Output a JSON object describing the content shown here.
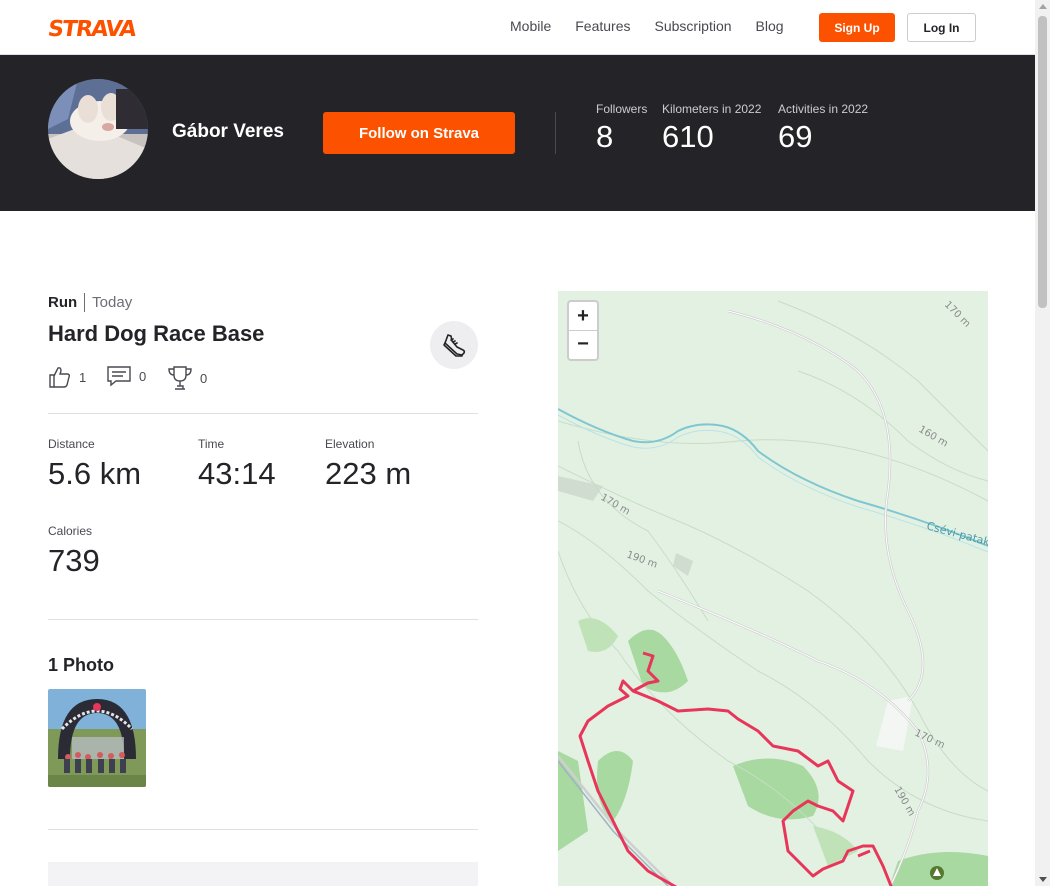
{
  "brand": {
    "logo_text": "STRAVA",
    "accent": "#fc5200",
    "dark": "#242428"
  },
  "nav": {
    "links": [
      "Mobile",
      "Features",
      "Subscription",
      "Blog"
    ],
    "signup_label": "Sign Up",
    "login_label": "Log In"
  },
  "athlete": {
    "name": "Gábor Veres",
    "follow_label": "Follow on Strava",
    "stats": [
      {
        "label": "Followers",
        "value": "8"
      },
      {
        "label": "Kilometers in 2022",
        "value": "610"
      },
      {
        "label": "Activities in 2022",
        "value": "69"
      }
    ]
  },
  "activity": {
    "type": "Run",
    "date": "Today",
    "title": "Hard Dog Race Base",
    "sport_icon": "running-shoe-icon",
    "kudos_count": "1",
    "comments_count": "0",
    "achievements_count": "0",
    "metrics": {
      "distance": {
        "label": "Distance",
        "value": "5.6 km"
      },
      "time": {
        "label": "Time",
        "value": "43:14"
      },
      "elevation": {
        "label": "Elevation",
        "value": "223 m"
      },
      "calories": {
        "label": "Calories",
        "value": "739"
      }
    },
    "photos_title": "1 Photo"
  },
  "map": {
    "zoom_in": "+",
    "zoom_out": "−",
    "labels": {
      "c1": "170 m",
      "c2": "160 m",
      "c3": "170 m",
      "c4": "190 m",
      "c5": "170 m",
      "c6": "190 m",
      "stream": "Csévi-patak"
    },
    "route_color": "#e8365a"
  }
}
